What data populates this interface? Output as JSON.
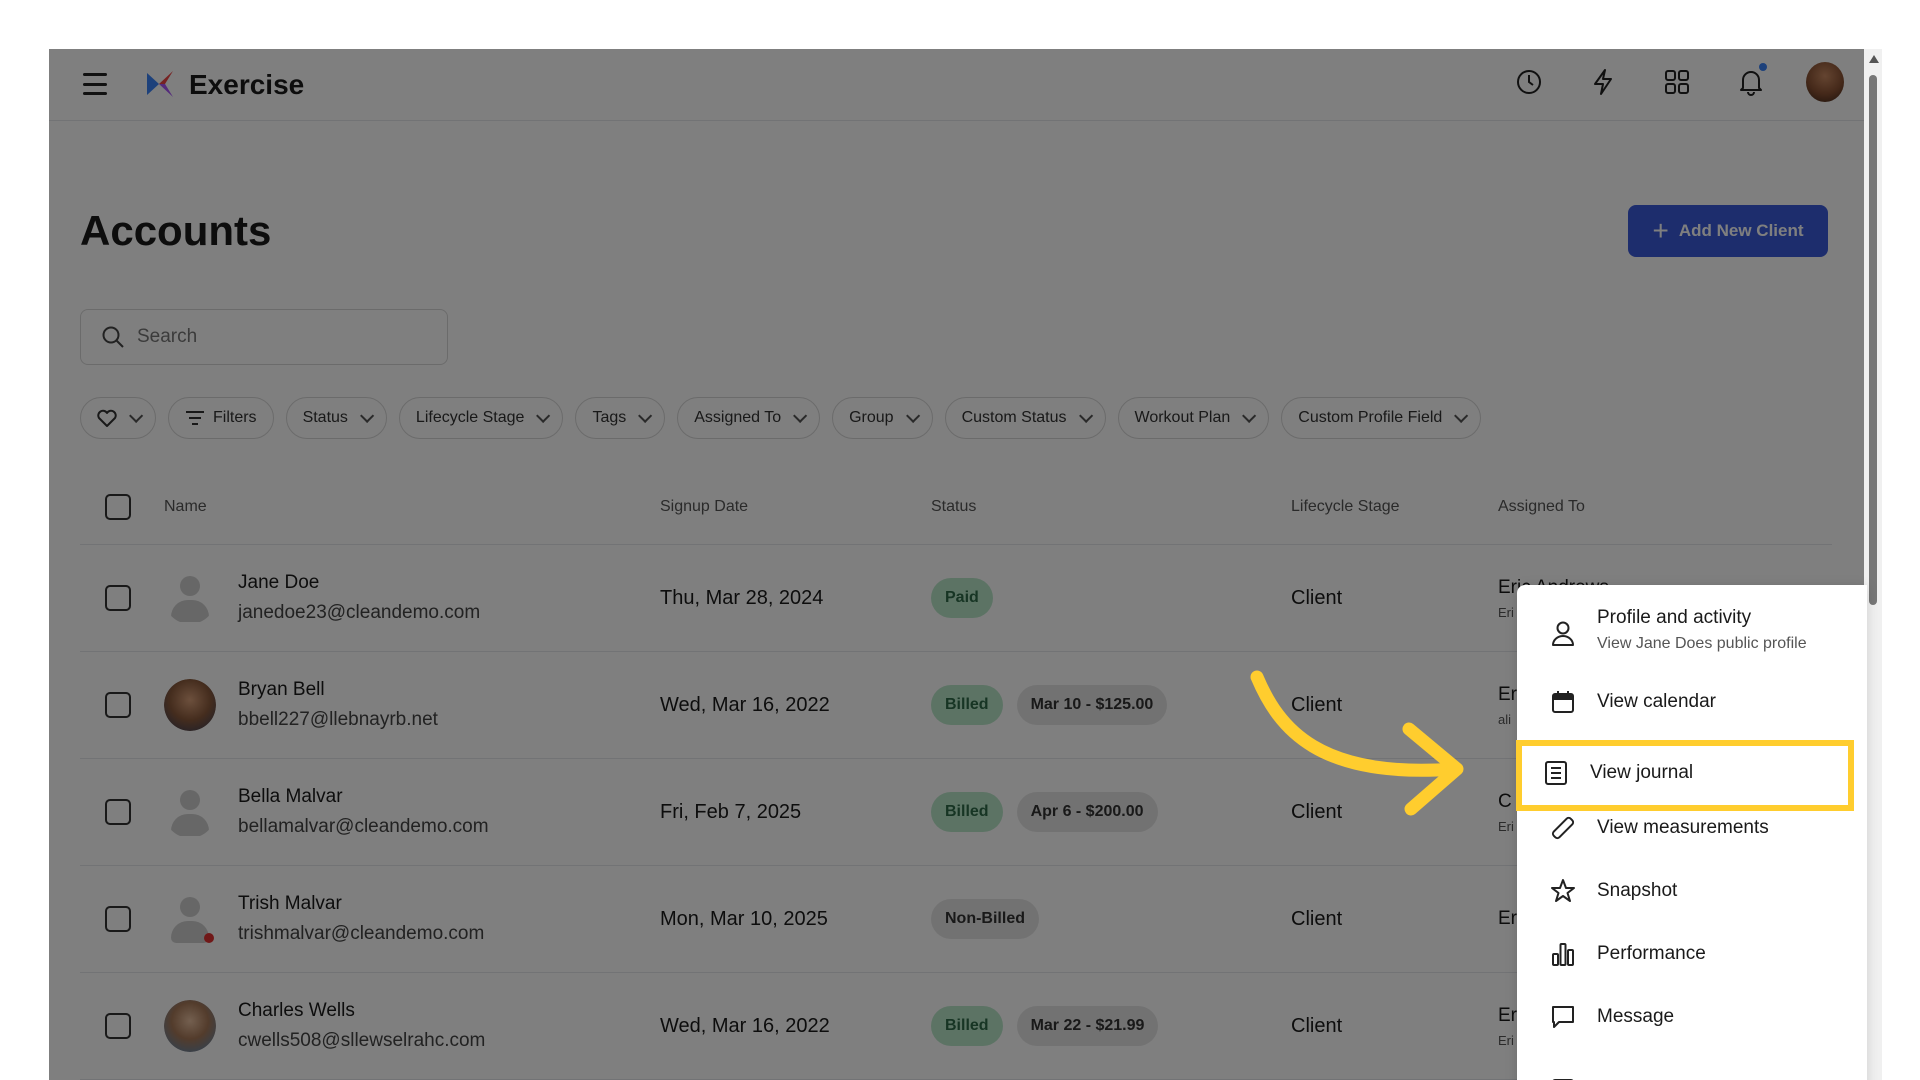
{
  "app": {
    "title": "Exercise"
  },
  "page": {
    "title": "Accounts",
    "add_button": "Add New Client"
  },
  "search": {
    "placeholder": "Search"
  },
  "filters": [
    "Filters",
    "Status",
    "Lifecycle Stage",
    "Tags",
    "Assigned To",
    "Group",
    "Custom Status",
    "Workout Plan",
    "Custom Profile Field"
  ],
  "table": {
    "headers": {
      "name": "Name",
      "signup_date": "Signup Date",
      "status": "Status",
      "lifecycle_stage": "Lifecycle Stage",
      "assigned_to": "Assigned To"
    },
    "rows": [
      {
        "name": "Jane Doe",
        "email": "janedoe23@cleandemo.com",
        "date": "Thu, Mar 28, 2024",
        "status": "Paid",
        "billing": "",
        "stage": "Client",
        "assigned": "Eric Andrews",
        "assigned_sub": "Eri"
      },
      {
        "name": "Bryan Bell",
        "email": "bbell227@llebnayrb.net",
        "date": "Wed, Mar 16, 2022",
        "status": "Billed",
        "billing": "Mar 10 - $125.00",
        "stage": "Client",
        "assigned": "Er",
        "assigned_sub": "ali"
      },
      {
        "name": "Bella Malvar",
        "email": "bellamalvar@cleandemo.com",
        "date": "Fri, Feb 7, 2025",
        "status": "Billed",
        "billing": "Apr 6 - $200.00",
        "stage": "Client",
        "assigned": "C",
        "assigned_sub": "Eri"
      },
      {
        "name": "Trish Malvar",
        "email": "trishmalvar@cleandemo.com",
        "date": "Mon, Mar 10, 2025",
        "status": "Non-Billed",
        "billing": "",
        "stage": "Client",
        "assigned": "Er",
        "assigned_sub": ""
      },
      {
        "name": "Charles Wells",
        "email": "cwells508@sllewselrahc.com",
        "date": "Wed, Mar 16, 2022",
        "status": "Billed",
        "billing": "Mar 22 - $21.99",
        "stage": "Client",
        "assigned": "Er",
        "assigned_sub": "Eri"
      }
    ]
  },
  "menu": {
    "profile": {
      "label": "Profile and activity",
      "sub": "View Jane Does public profile"
    },
    "calendar": "View calendar",
    "journal": "View journal",
    "measurements": "View measurements",
    "snapshot": "Snapshot",
    "performance": "Performance",
    "message": "Message"
  },
  "colors": {
    "accent": "#3b5bdb",
    "highlight": "#ffcd2e",
    "paid_badge": "#b8e6c9"
  }
}
